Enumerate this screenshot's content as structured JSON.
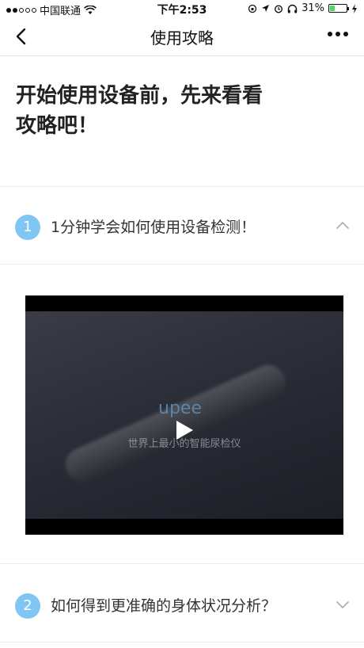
{
  "status_bar": {
    "carrier": "中国联通",
    "time": "下午2:53",
    "battery_percent": "31%",
    "battery_level": 0.31
  },
  "nav": {
    "title": "使用攻略",
    "back_icon": "chevron-left-icon",
    "more_icon": "more-icon"
  },
  "headline": {
    "line1": "开始使用设备前，先来看看",
    "line2": "攻略吧！"
  },
  "sections": [
    {
      "number": "1",
      "label": "1分钟学会如何使用设备检测！",
      "expanded": true,
      "video": {
        "brand": "upee",
        "caption": "世界上最小的智能尿检仪"
      }
    },
    {
      "number": "2",
      "label": "如何得到更准确的身体状况分析？",
      "expanded": false
    }
  ],
  "colors": {
    "accent": "#7fc6f4",
    "battery": "#4cd964",
    "divider": "#ececec"
  }
}
